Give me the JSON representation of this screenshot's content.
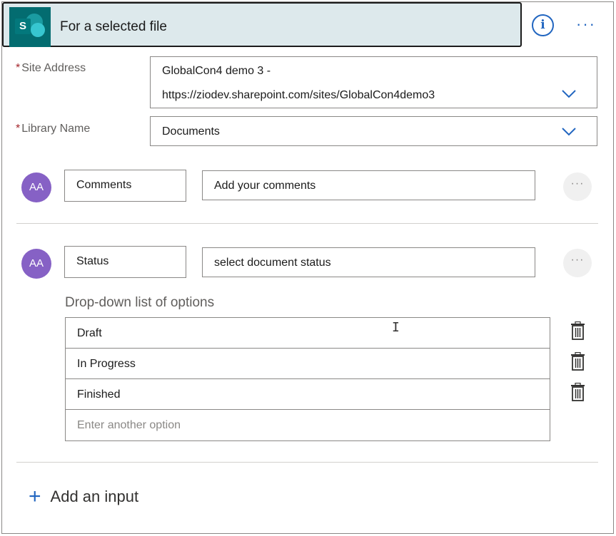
{
  "header": {
    "title": "For a selected file",
    "logo_letter": "S",
    "info_glyph": "i",
    "more_glyph": "···"
  },
  "site_address": {
    "label": "Site Address",
    "required_mark": "*",
    "value_line1": "GlobalCon4 demo 3 -",
    "value_line2": "https://ziodev.sharepoint.com/sites/GlobalCon4demo3"
  },
  "library_name": {
    "label": "Library Name",
    "required_mark": "*",
    "value": "Documents"
  },
  "inputs": [
    {
      "avatar_text": "AA",
      "name": "Comments",
      "description": "Add your comments",
      "menu_glyph": "···"
    },
    {
      "avatar_text": "AA",
      "name": "Status",
      "description": "select document status",
      "menu_glyph": "···"
    }
  ],
  "dropdown": {
    "label": "Drop-down list of options",
    "options": [
      "Draft",
      "In Progress",
      "Finished"
    ],
    "placeholder": "Enter another option"
  },
  "add_input": {
    "plus": "+",
    "label": "Add an input"
  },
  "colors": {
    "accent": "#2266c0",
    "header_bg": "#dde9ec",
    "avatar": "#8661c5",
    "required": "#a4262c"
  }
}
